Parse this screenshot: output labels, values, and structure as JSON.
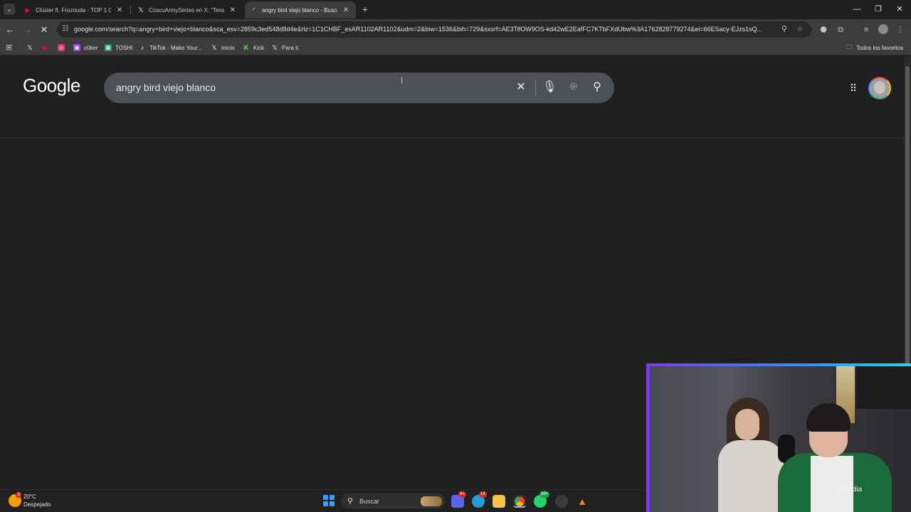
{
  "tabs": [
    {
      "title": "Clúster ft. Frozouda - TOP 1 CH",
      "favicon": "youtube-icon",
      "color": "#ff0033",
      "active": false
    },
    {
      "title": "CoscuArmySeries en X: \"Tenes c",
      "favicon": "x-icon",
      "color": "#ffffff",
      "active": false
    },
    {
      "title": "angry bird viejo blanco - Buscar",
      "favicon": "loading-icon",
      "color": "#e3e3e3",
      "active": true
    }
  ],
  "toolbar": {
    "url": "google.com/search?q=angry+bird+viejo+blanco&sca_esv=2859c3ed548d8d4e&rlz=1C1CHBF_esAR1102AR1102&udm=2&biw=1536&bih=729&sxsrf=AE3TifOW9OS-kd42wE2EafFC7KTbFXdUbw%3A1762828779274&ei=66ESacy-EJzs1sQ..."
  },
  "bookmarks": {
    "items": [
      {
        "label": "",
        "icon": "x-icon",
        "color": "#ffffff"
      },
      {
        "label": "",
        "icon": "youtube-icon",
        "color": "#ff0033"
      },
      {
        "label": "",
        "icon": "instagram-icon",
        "color": "#e1306c"
      },
      {
        "label": "c0ker",
        "icon": "twitch-icon",
        "color": "#9146ff"
      },
      {
        "label": "TOSHI",
        "icon": "sheets-icon",
        "color": "#1fa463"
      },
      {
        "label": "TikTok - Make Your...",
        "icon": "tiktok-icon",
        "color": "#ffffff"
      },
      {
        "label": "Inicio",
        "icon": "x-icon",
        "color": "#ffffff"
      },
      {
        "label": "Kick",
        "icon": "kick-icon",
        "color": "#53fc18"
      },
      {
        "label": "Para ti",
        "icon": "x-icon",
        "color": "#ffffff"
      }
    ],
    "all_favorites": "Todos los favoritos"
  },
  "search": {
    "logo": "Google",
    "query": "angry bird viejo blanco"
  },
  "webcam": {
    "logo": "Expedia"
  },
  "taskbar": {
    "temperature": "20°C",
    "weather": "Despejado",
    "weather_badge": "3",
    "search_label": "Buscar",
    "badges": {
      "discord": "9+",
      "telegram": "14",
      "whatsapp": "99+"
    }
  }
}
